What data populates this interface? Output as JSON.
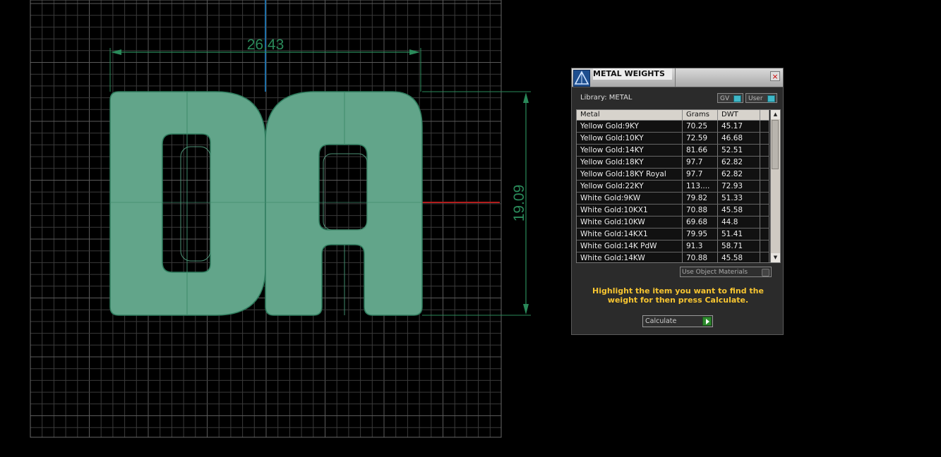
{
  "viewport": {
    "dimension_width": "26.43",
    "dimension_height": "19.09",
    "colors": {
      "shape_fill": "#62a58a",
      "dimension_line": "#2a8a5a",
      "grid_line": "#404040",
      "axis_y": "#1e6fa8",
      "axis_x": "#b21c1c"
    }
  },
  "dialog": {
    "title": "METAL WEIGHTS",
    "close_glyph": "×",
    "library_label": "Library: METAL",
    "gv_label": "GV",
    "user_label": "User",
    "columns": [
      "Metal",
      "Grams",
      "DWT"
    ],
    "rows": [
      {
        "metal": "Yellow Gold:9KY",
        "grams": "70.25",
        "dwt": "45.17"
      },
      {
        "metal": "Yellow Gold:10KY",
        "grams": "72.59",
        "dwt": "46.68"
      },
      {
        "metal": "Yellow Gold:14KY",
        "grams": "81.66",
        "dwt": "52.51"
      },
      {
        "metal": "Yellow Gold:18KY",
        "grams": "97.7",
        "dwt": "62.82"
      },
      {
        "metal": "Yellow Gold:18KY Royal",
        "grams": "97.7",
        "dwt": "62.82"
      },
      {
        "metal": "Yellow Gold:22KY",
        "grams": "113....",
        "dwt": "72.93"
      },
      {
        "metal": "White Gold:9KW",
        "grams": "79.82",
        "dwt": "51.33"
      },
      {
        "metal": "White Gold:10KX1",
        "grams": "70.88",
        "dwt": "45.58"
      },
      {
        "metal": "White Gold:10KW",
        "grams": "69.68",
        "dwt": "44.8"
      },
      {
        "metal": "White Gold:14KX1",
        "grams": "79.95",
        "dwt": "51.41"
      },
      {
        "metal": "White Gold:14K PdW",
        "grams": "91.3",
        "dwt": "58.71"
      },
      {
        "metal": "White Gold:14KW",
        "grams": "70.88",
        "dwt": "45.58"
      }
    ],
    "use_object_materials": "Use Object Materials",
    "instruction": "Highlight the item you want to find the weight for then press Calculate.",
    "calculate_label": "Calculate",
    "accent_color": "#f7c531"
  }
}
